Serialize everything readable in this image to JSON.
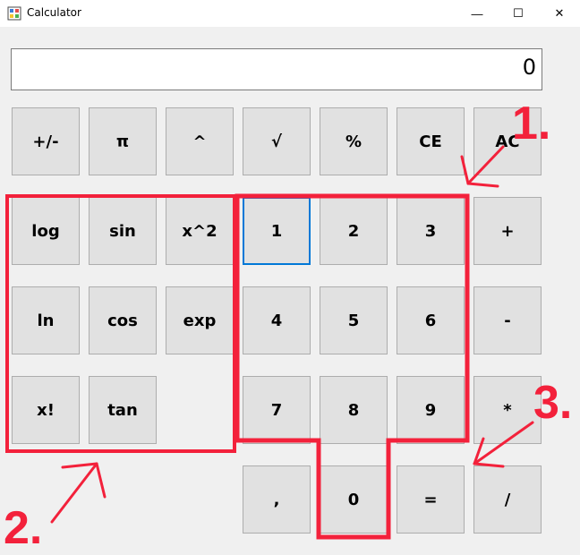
{
  "window": {
    "title": "Calculator",
    "controls": {
      "minimize": "—",
      "maximize": "☐",
      "close": "✕"
    }
  },
  "display": {
    "value": "0"
  },
  "buttons": {
    "sign": "+/-",
    "pi": "π",
    "power": "^",
    "sqrt": "√",
    "percent": "%",
    "ce": "CE",
    "ac": "AC",
    "log": "log",
    "sin": "sin",
    "square": "x^2",
    "one": "1",
    "two": "2",
    "three": "3",
    "plus": "+",
    "ln": "ln",
    "cos": "cos",
    "exp": "exp",
    "four": "4",
    "five": "5",
    "six": "6",
    "minus": "-",
    "factorial": "x!",
    "tan": "tan",
    "seven": "7",
    "eight": "8",
    "nine": "9",
    "multiply": "*",
    "comma": ",",
    "zero": "0",
    "equals": "=",
    "divide": "/"
  },
  "annotations": {
    "label1": "1.",
    "label2": "2.",
    "label3": "3.",
    "color": "#f3213b"
  }
}
